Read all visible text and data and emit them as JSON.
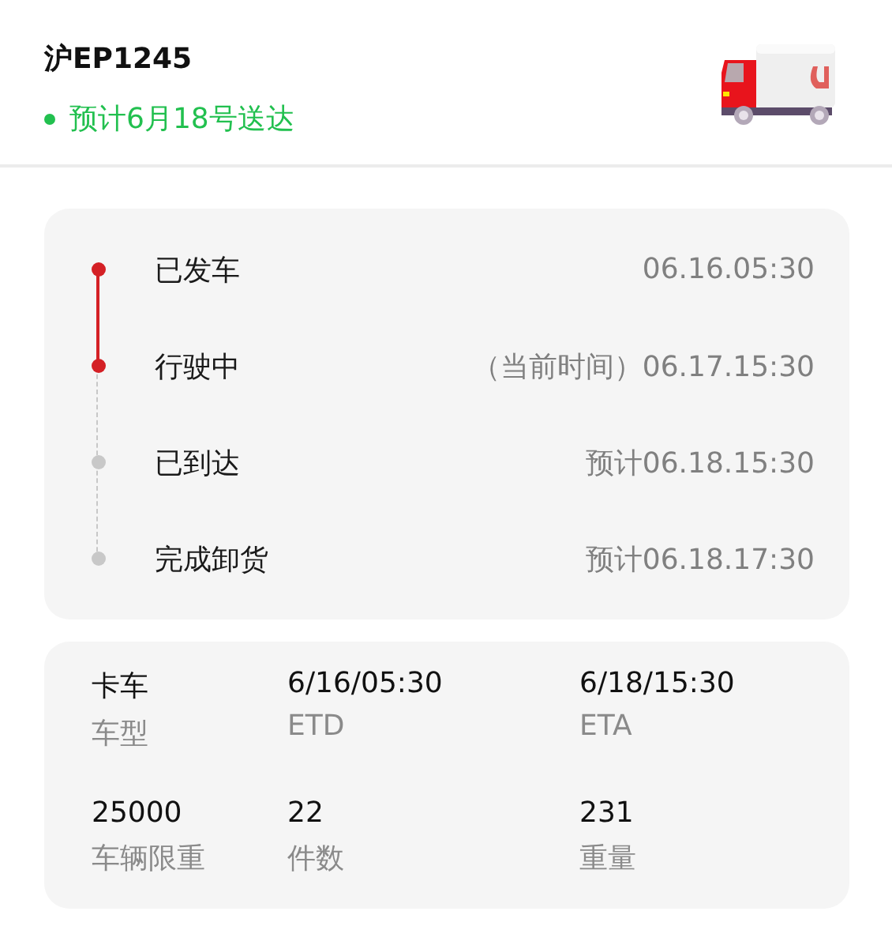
{
  "header": {
    "plate": "沪EP1245",
    "eta_text": "预计6月18号送达"
  },
  "timeline": [
    {
      "label": "已发车",
      "time": "06.16.05:30",
      "done": true
    },
    {
      "label": "行驶中",
      "time": "（当前时间）06.17.15:30",
      "done": true
    },
    {
      "label": "已到达",
      "time": "预计06.18.15:30",
      "done": false
    },
    {
      "label": "完成卸货",
      "time": "预计06.18.17:30",
      "done": false
    }
  ],
  "details": [
    {
      "value": "卡车",
      "label": "车型"
    },
    {
      "value": "6/16/05:30",
      "label": "ETD"
    },
    {
      "value": "6/18/15:30",
      "label": "ETA"
    },
    {
      "value": "25000",
      "label": "车辆限重"
    },
    {
      "value": "22",
      "label": "件数"
    },
    {
      "value": "231",
      "label": "重量"
    }
  ]
}
